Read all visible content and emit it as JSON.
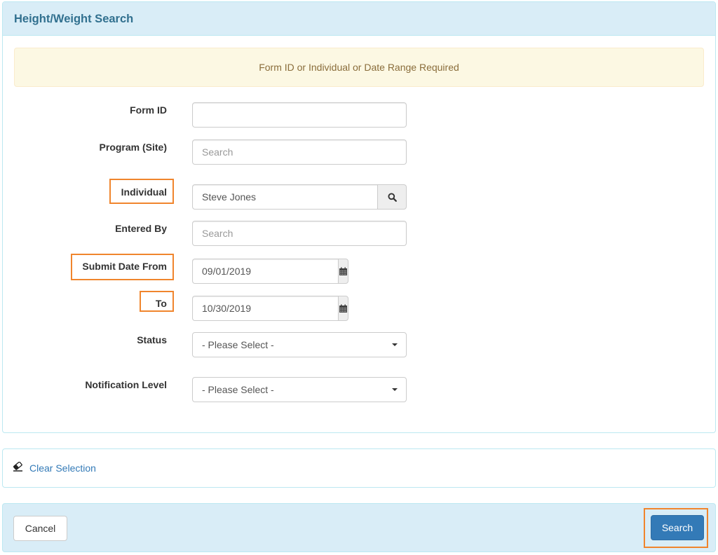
{
  "panel": {
    "title": "Height/Weight Search"
  },
  "alert": {
    "message": "Form ID or Individual or Date Range Required"
  },
  "form": {
    "form_id": {
      "label": "Form ID",
      "value": "",
      "placeholder": ""
    },
    "program_site": {
      "label": "Program (Site)",
      "value": "",
      "placeholder": "Search"
    },
    "individual": {
      "label": "Individual",
      "value": "Steve Jones",
      "button_icon": "search-icon"
    },
    "entered_by": {
      "label": "Entered By",
      "value": "",
      "placeholder": "Search"
    },
    "submit_date_from": {
      "label": "Submit Date From",
      "value": "09/01/2019",
      "button_icon": "calendar-icon"
    },
    "submit_date_to": {
      "label": "To",
      "value": "10/30/2019",
      "button_icon": "calendar-icon"
    },
    "status": {
      "label": "Status",
      "selected": "- Please Select -"
    },
    "notification_level": {
      "label": "Notification Level",
      "selected": "- Please Select -"
    }
  },
  "clear": {
    "label": "Clear Selection",
    "icon": "eraser-icon"
  },
  "footer": {
    "cancel_label": "Cancel",
    "search_label": "Search"
  },
  "colors": {
    "highlight": "#f0852d",
    "primary": "#337ab7",
    "panel_heading": "#d9edf7",
    "alert_bg": "#fcf8e3"
  }
}
